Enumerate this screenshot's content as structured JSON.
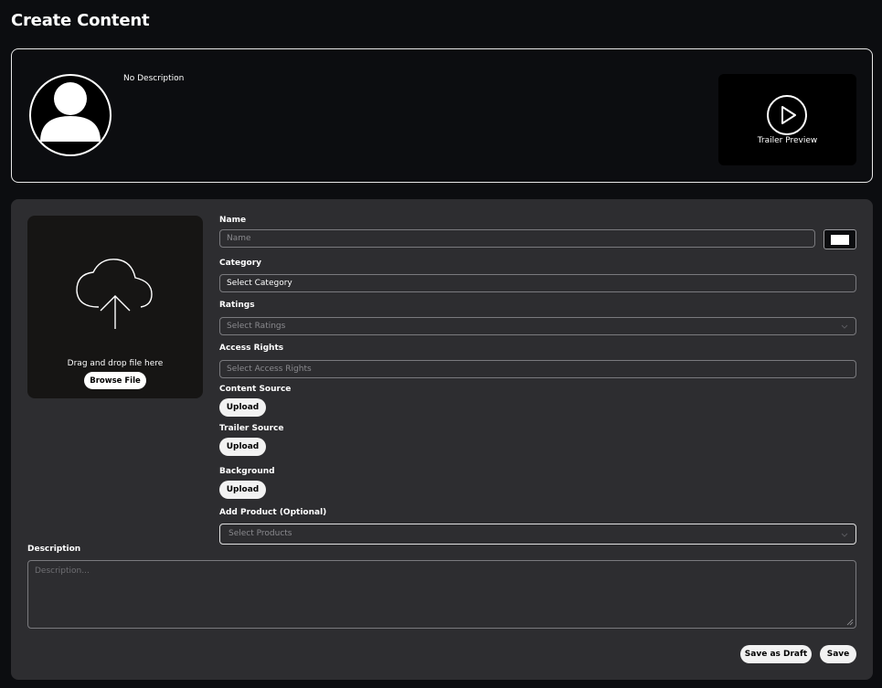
{
  "page": {
    "title": "Create Content"
  },
  "preview": {
    "description": "No Description",
    "trailer_label": "Trailer Preview"
  },
  "dropzone": {
    "text": "Drag and drop file here",
    "browse_label": "Browse File"
  },
  "form": {
    "name": {
      "label": "Name",
      "placeholder": "Name",
      "color": "#ffffff"
    },
    "category": {
      "label": "Category",
      "value": "Select Category"
    },
    "ratings": {
      "label": "Ratings",
      "placeholder": "Select Ratings"
    },
    "access_rights": {
      "label": "Access Rights",
      "placeholder": "Select Access Rights"
    },
    "content_source": {
      "label": "Content Source",
      "button": "Upload"
    },
    "trailer_source": {
      "label": "Trailer Source",
      "button": "Upload"
    },
    "background": {
      "label": "Background",
      "button": "Upload"
    },
    "product": {
      "label": "Add Product (Optional)",
      "placeholder": "Select Products"
    },
    "description": {
      "label": "Description",
      "placeholder": "Description..."
    }
  },
  "actions": {
    "save_draft": "Save as Draft",
    "save": "Save"
  }
}
